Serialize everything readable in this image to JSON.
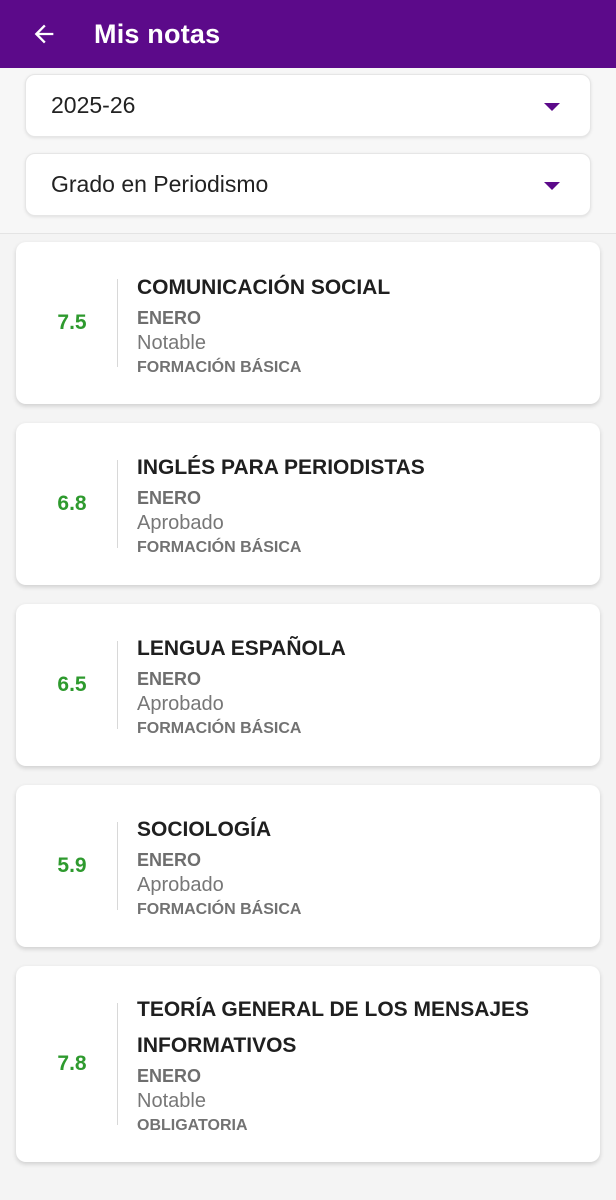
{
  "header": {
    "title": "Mis notas",
    "back_icon": "arrow-left-icon",
    "color": "#5c0a8a"
  },
  "filters": {
    "year": "2025-26",
    "degree": "Grado en Periodismo"
  },
  "courses": [
    {
      "grade": "7.5",
      "subject": "COMUNICACIÓN SOCIAL",
      "convocatoria": "ENERO",
      "result": "Notable",
      "type": "FORMACIÓN BÁSICA"
    },
    {
      "grade": "6.8",
      "subject": "INGLÉS PARA PERIODISTAS",
      "convocatoria": "ENERO",
      "result": "Aprobado",
      "type": "FORMACIÓN BÁSICA"
    },
    {
      "grade": "6.5",
      "subject": "LENGUA ESPAÑOLA",
      "convocatoria": "ENERO",
      "result": "Aprobado",
      "type": "FORMACIÓN BÁSICA"
    },
    {
      "grade": "5.9",
      "subject": "SOCIOLOGÍA",
      "convocatoria": "ENERO",
      "result": "Aprobado",
      "type": "FORMACIÓN BÁSICA"
    },
    {
      "grade": "7.8",
      "subject": "TEORÍA GENERAL DE LOS MENSAJES INFORMATIVOS",
      "convocatoria": "ENERO",
      "result": "Notable",
      "type": "OBLIGATORIA"
    }
  ],
  "colors": {
    "grade": "#2e9a2e",
    "accent": "#5c0a8a"
  }
}
